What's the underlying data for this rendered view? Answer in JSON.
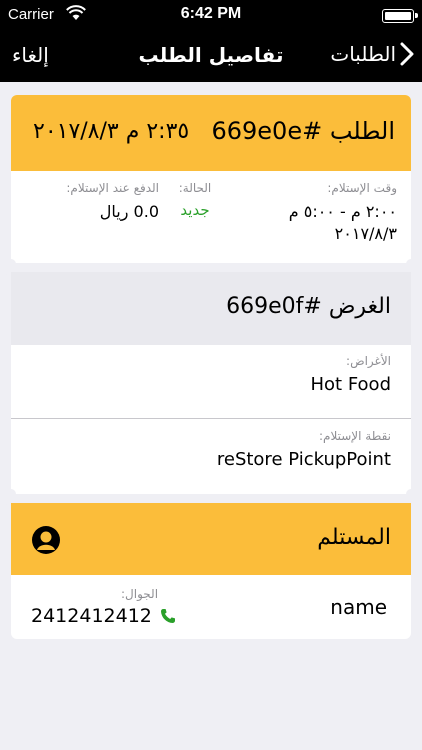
{
  "status_bar": {
    "carrier": "Carrier",
    "time": "6:42 PM",
    "battery_level": 100
  },
  "nav": {
    "back_label": "الطلبات",
    "title": "تفاصيل الطلب",
    "cancel_label": "إلغاء"
  },
  "order": {
    "id_text": "الطلب #669e0e",
    "datetime": "٢:٣٥ م ٢٠١٧/٨/٣",
    "pickup_time_label": "وقت الإستلام:",
    "pickup_time_value": "٢:٠٠ م - ٥:٠٠ م ٢٠١٧/٨/٣",
    "status_label": "الحالة:",
    "status_value": "جديد",
    "payment_label": "الدفع عند الإستلام:",
    "payment_value": "0.0 ريال"
  },
  "item": {
    "id_text": "الغرض #669e0f",
    "items_label": "الأغراض:",
    "items_value": "Hot Food",
    "pickup_point_label": "نقطة الإستلام:",
    "pickup_point_value": "reStore PickupPoint"
  },
  "recipient": {
    "title": "المستلم",
    "name": "name",
    "mobile_label": "الجوال:",
    "mobile_value": "2412412412"
  },
  "colors": {
    "accent": "#fbbd3a",
    "status_new": "#2aa02a",
    "phone_icon": "#2aa02a",
    "nav_bg": "#000000"
  },
  "icons": {
    "back": "chevron-right-icon",
    "wifi": "wifi-icon",
    "battery": "battery-icon",
    "recipient": "user-icon",
    "phone": "phone-icon"
  }
}
